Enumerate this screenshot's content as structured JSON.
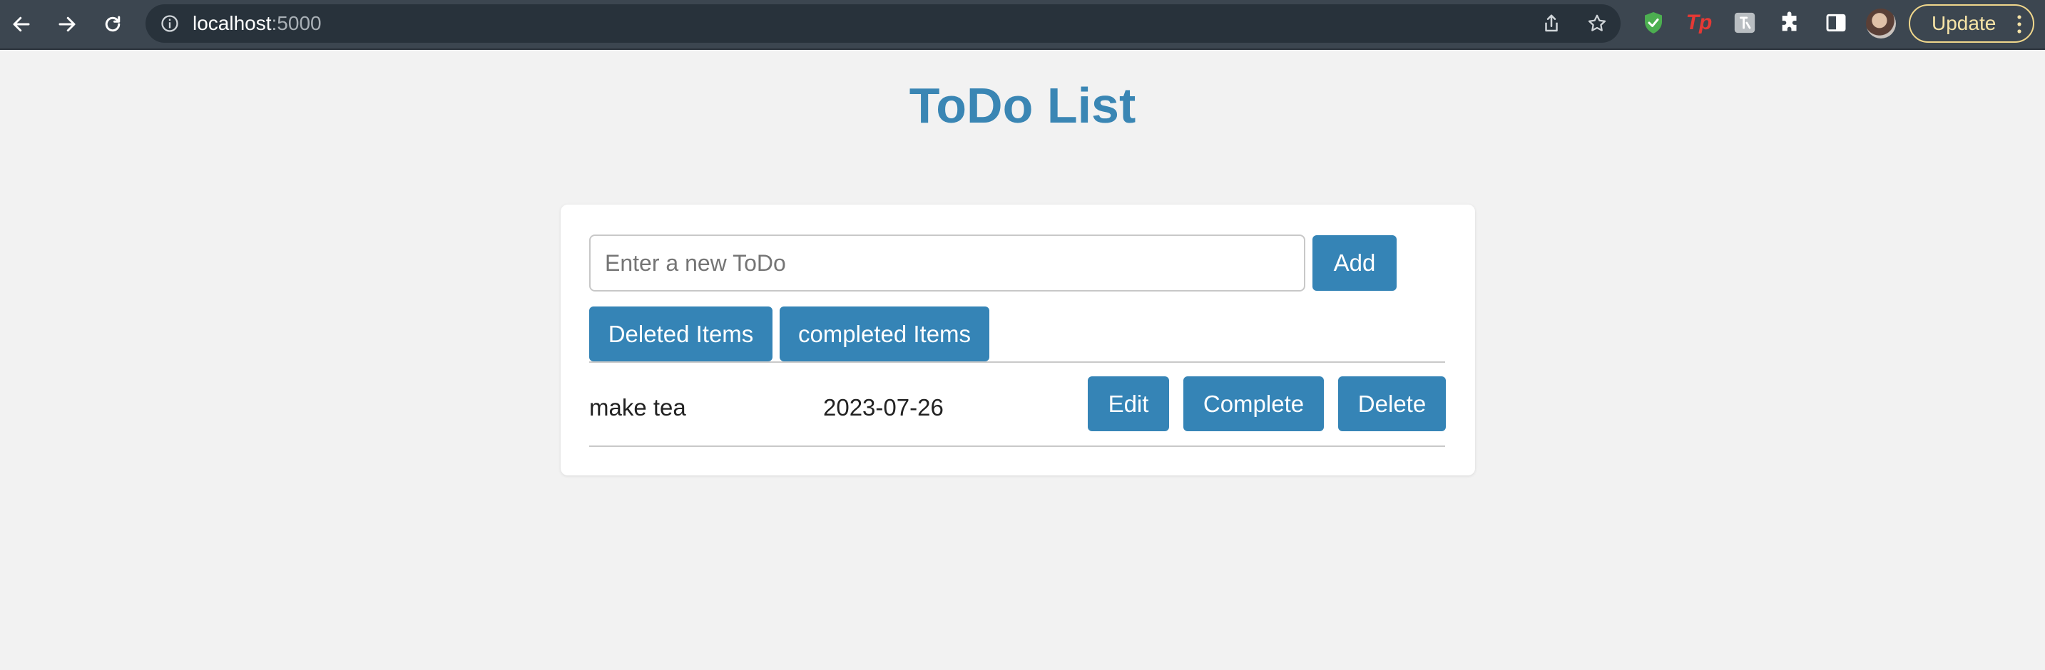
{
  "browser": {
    "url_host": "localhost",
    "url_port": ":5000",
    "update_label": "Update",
    "icons": [
      "back-icon",
      "forward-icon",
      "reload-icon",
      "info-icon",
      "share-icon",
      "bookmark-star-icon",
      "shield-extension-icon",
      "tp-extension-icon",
      "translate-extension-icon",
      "puzzle-extensions-icon",
      "sidebar-icon",
      "avatar",
      "kebab-menu-icon"
    ],
    "update_color": "#f0d78c",
    "tp_label": "Tp"
  },
  "page": {
    "title": "ToDo List",
    "accent_color": "#3584b6"
  },
  "form": {
    "input_placeholder": "Enter a new ToDo",
    "input_value": "",
    "add_label": "Add"
  },
  "filters": {
    "deleted_label": "Deleted Items",
    "completed_label": "completed Items"
  },
  "todos": [
    {
      "text": "make tea",
      "date": "2023-07-26",
      "edit_label": "Edit",
      "complete_label": "Complete",
      "delete_label": "Delete"
    }
  ]
}
